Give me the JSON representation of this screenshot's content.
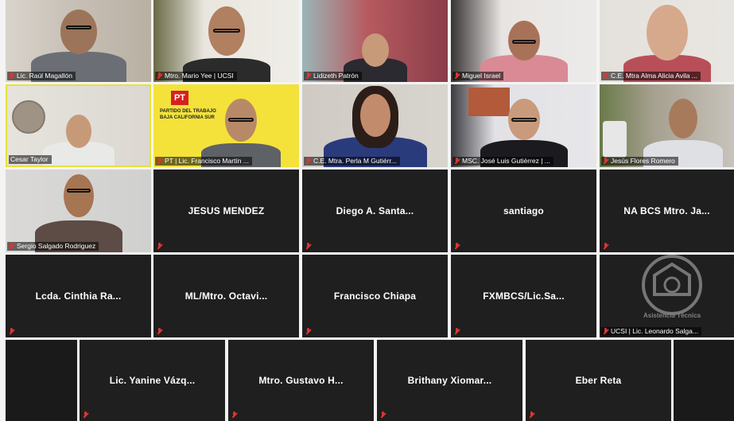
{
  "app": {
    "name": "Zoom meeting gallery view"
  },
  "colors": {
    "tile_bg": "#1f1f1f",
    "active_border": "#e6e23a",
    "muted_mic": "#e0342f"
  },
  "video_tiles": [
    {
      "name": "Lic. Raúl Magallón"
    },
    {
      "name": "Mtro. Mario Yee | UCSI"
    },
    {
      "name": "Lidizeth Patrón"
    },
    {
      "name": "Miguel Israel"
    },
    {
      "name": "C.E. Mtra Alma Alicia Avila ..."
    },
    {
      "name": "Cesar Taylor"
    },
    {
      "name": "PT | Lic. Francisco Martín ...",
      "sign_logo": "PT",
      "sign_text": "PARTIDO DEL TRABAJO\nBAJA CALIFORNIA SUR"
    },
    {
      "name": "C.E. Mtra. Perla M Gutiérr..."
    },
    {
      "name": "MSC. José Luis Gutiérrez | ..."
    },
    {
      "name": "Jesús Flores Romero"
    },
    {
      "name": "Sergio Salgado Rodriguez"
    }
  ],
  "name_tiles": [
    {
      "display": "JESUS MENDEZ"
    },
    {
      "display": "Diego A. Santa..."
    },
    {
      "display": "santiago"
    },
    {
      "display": "NA BCS Mtro. Ja..."
    },
    {
      "display": "Lcda. Cinthia Ra..."
    },
    {
      "display": "ML/Mtro. Octavi..."
    },
    {
      "display": "Francisco Chiapa"
    },
    {
      "display": "FXMBCS/Lic.Sa..."
    },
    {
      "display": "",
      "label": "UCSI | Lic. Leonardo Salga..."
    },
    {
      "display": "Lic. Yanine Vázq..."
    },
    {
      "display": "Mtro. Gustavo H..."
    },
    {
      "display": "Brithany Xiomar..."
    },
    {
      "display": "Eber Reta"
    }
  ],
  "watermark": {
    "text": "Asistencia Técnica"
  }
}
